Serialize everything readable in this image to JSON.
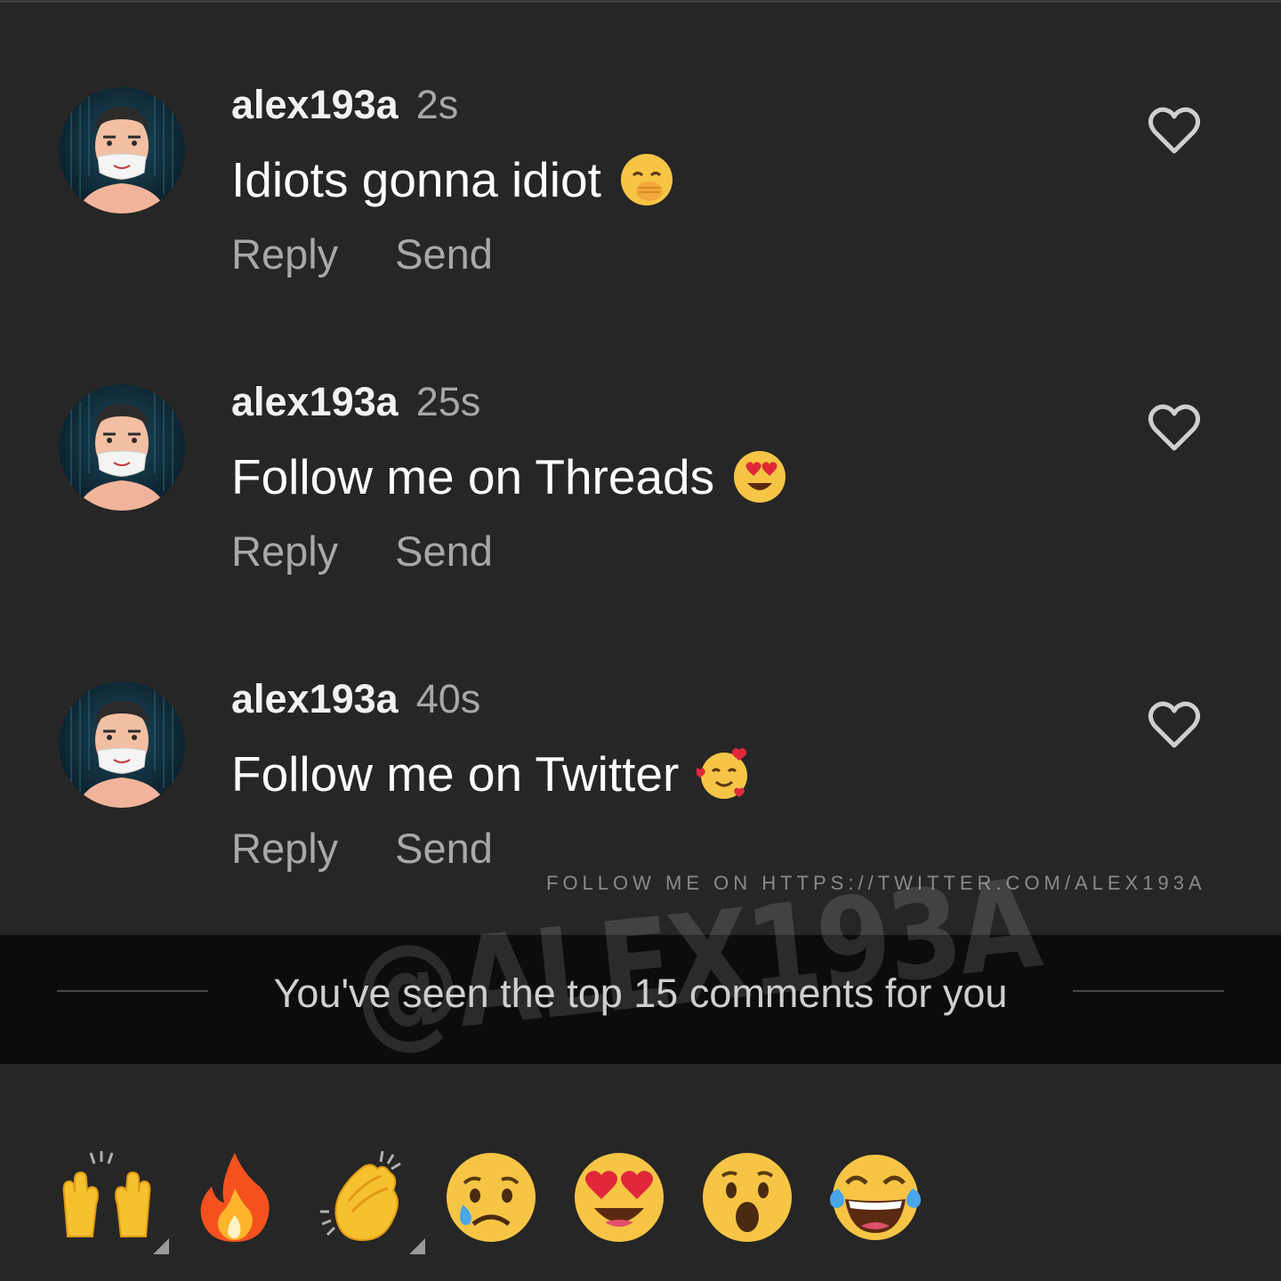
{
  "comments": [
    {
      "username": "alex193a",
      "time": "2s",
      "text": "Idiots gonna idiot",
      "emoji": "hand-over-mouth-emoji",
      "reply_label": "Reply",
      "send_label": "Send"
    },
    {
      "username": "alex193a",
      "time": "25s",
      "text": "Follow me on Threads",
      "emoji": "heart-eyes-emoji",
      "reply_label": "Reply",
      "send_label": "Send"
    },
    {
      "username": "alex193a",
      "time": "40s",
      "text": "Follow me on Twitter",
      "emoji": "smiling-face-with-hearts-emoji",
      "reply_label": "Reply",
      "send_label": "Send"
    }
  ],
  "watermark": {
    "small": "FOLLOW ME ON HTTPS://TWITTER.COM/ALEX193A",
    "large": "@ALEX193A"
  },
  "end_banner": {
    "text": "You've seen the top 15 comments for you"
  },
  "quick_reactions": [
    "raising-hands-emoji",
    "fire-emoji",
    "clapping-hands-emoji",
    "crying-face-emoji",
    "heart-eyes-emoji",
    "astonished-face-emoji",
    "tears-of-joy-emoji"
  ],
  "colors": {
    "background": "#262626",
    "banner": "#0c0c0c",
    "secondary_text": "#a8a8a8"
  }
}
